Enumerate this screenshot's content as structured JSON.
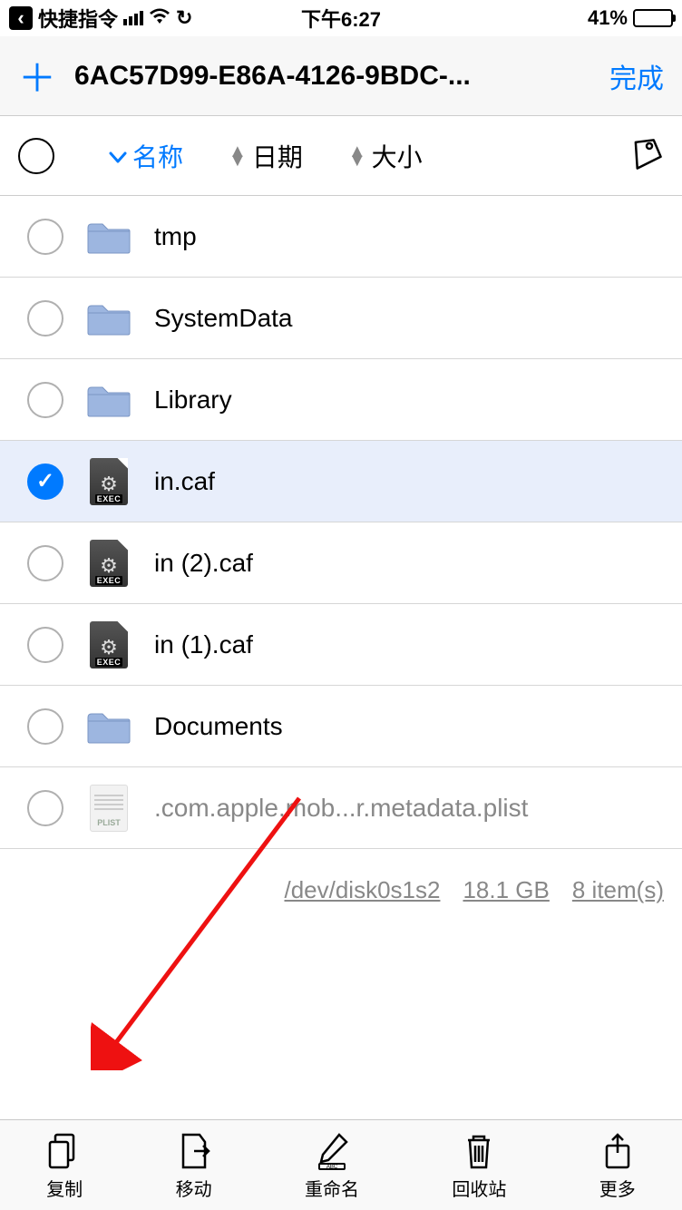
{
  "status": {
    "app_name": "快捷指令",
    "time": "下午6:27",
    "battery_percent": "41%",
    "battery_fill": 41
  },
  "nav": {
    "title": "6AC57D99-E86A-4126-9BDC-...",
    "done": "完成"
  },
  "sort": {
    "name": "名称",
    "date": "日期",
    "size": "大小"
  },
  "files": [
    {
      "name": "tmp",
      "type": "folder",
      "selected": false
    },
    {
      "name": "SystemData",
      "type": "folder",
      "selected": false
    },
    {
      "name": "Library",
      "type": "folder",
      "selected": false
    },
    {
      "name": "in.caf",
      "type": "exec",
      "selected": true
    },
    {
      "name": "in (2).caf",
      "type": "exec",
      "selected": false
    },
    {
      "name": "in (1).caf",
      "type": "exec",
      "selected": false
    },
    {
      "name": "Documents",
      "type": "folder",
      "selected": false
    },
    {
      "name": ".com.apple.mob...r.metadata.plist",
      "type": "plist",
      "selected": false,
      "dimmed": true
    }
  ],
  "footer": {
    "path": "/dev/disk0s1s2",
    "space": "18.1 GB",
    "count": "8 item(s)"
  },
  "toolbar": {
    "copy": "复制",
    "move": "移动",
    "rename": "重命名",
    "trash": "回收站",
    "more": "更多"
  },
  "icons": {
    "exec_label": "EXEC",
    "plist_label": "PLIST"
  }
}
